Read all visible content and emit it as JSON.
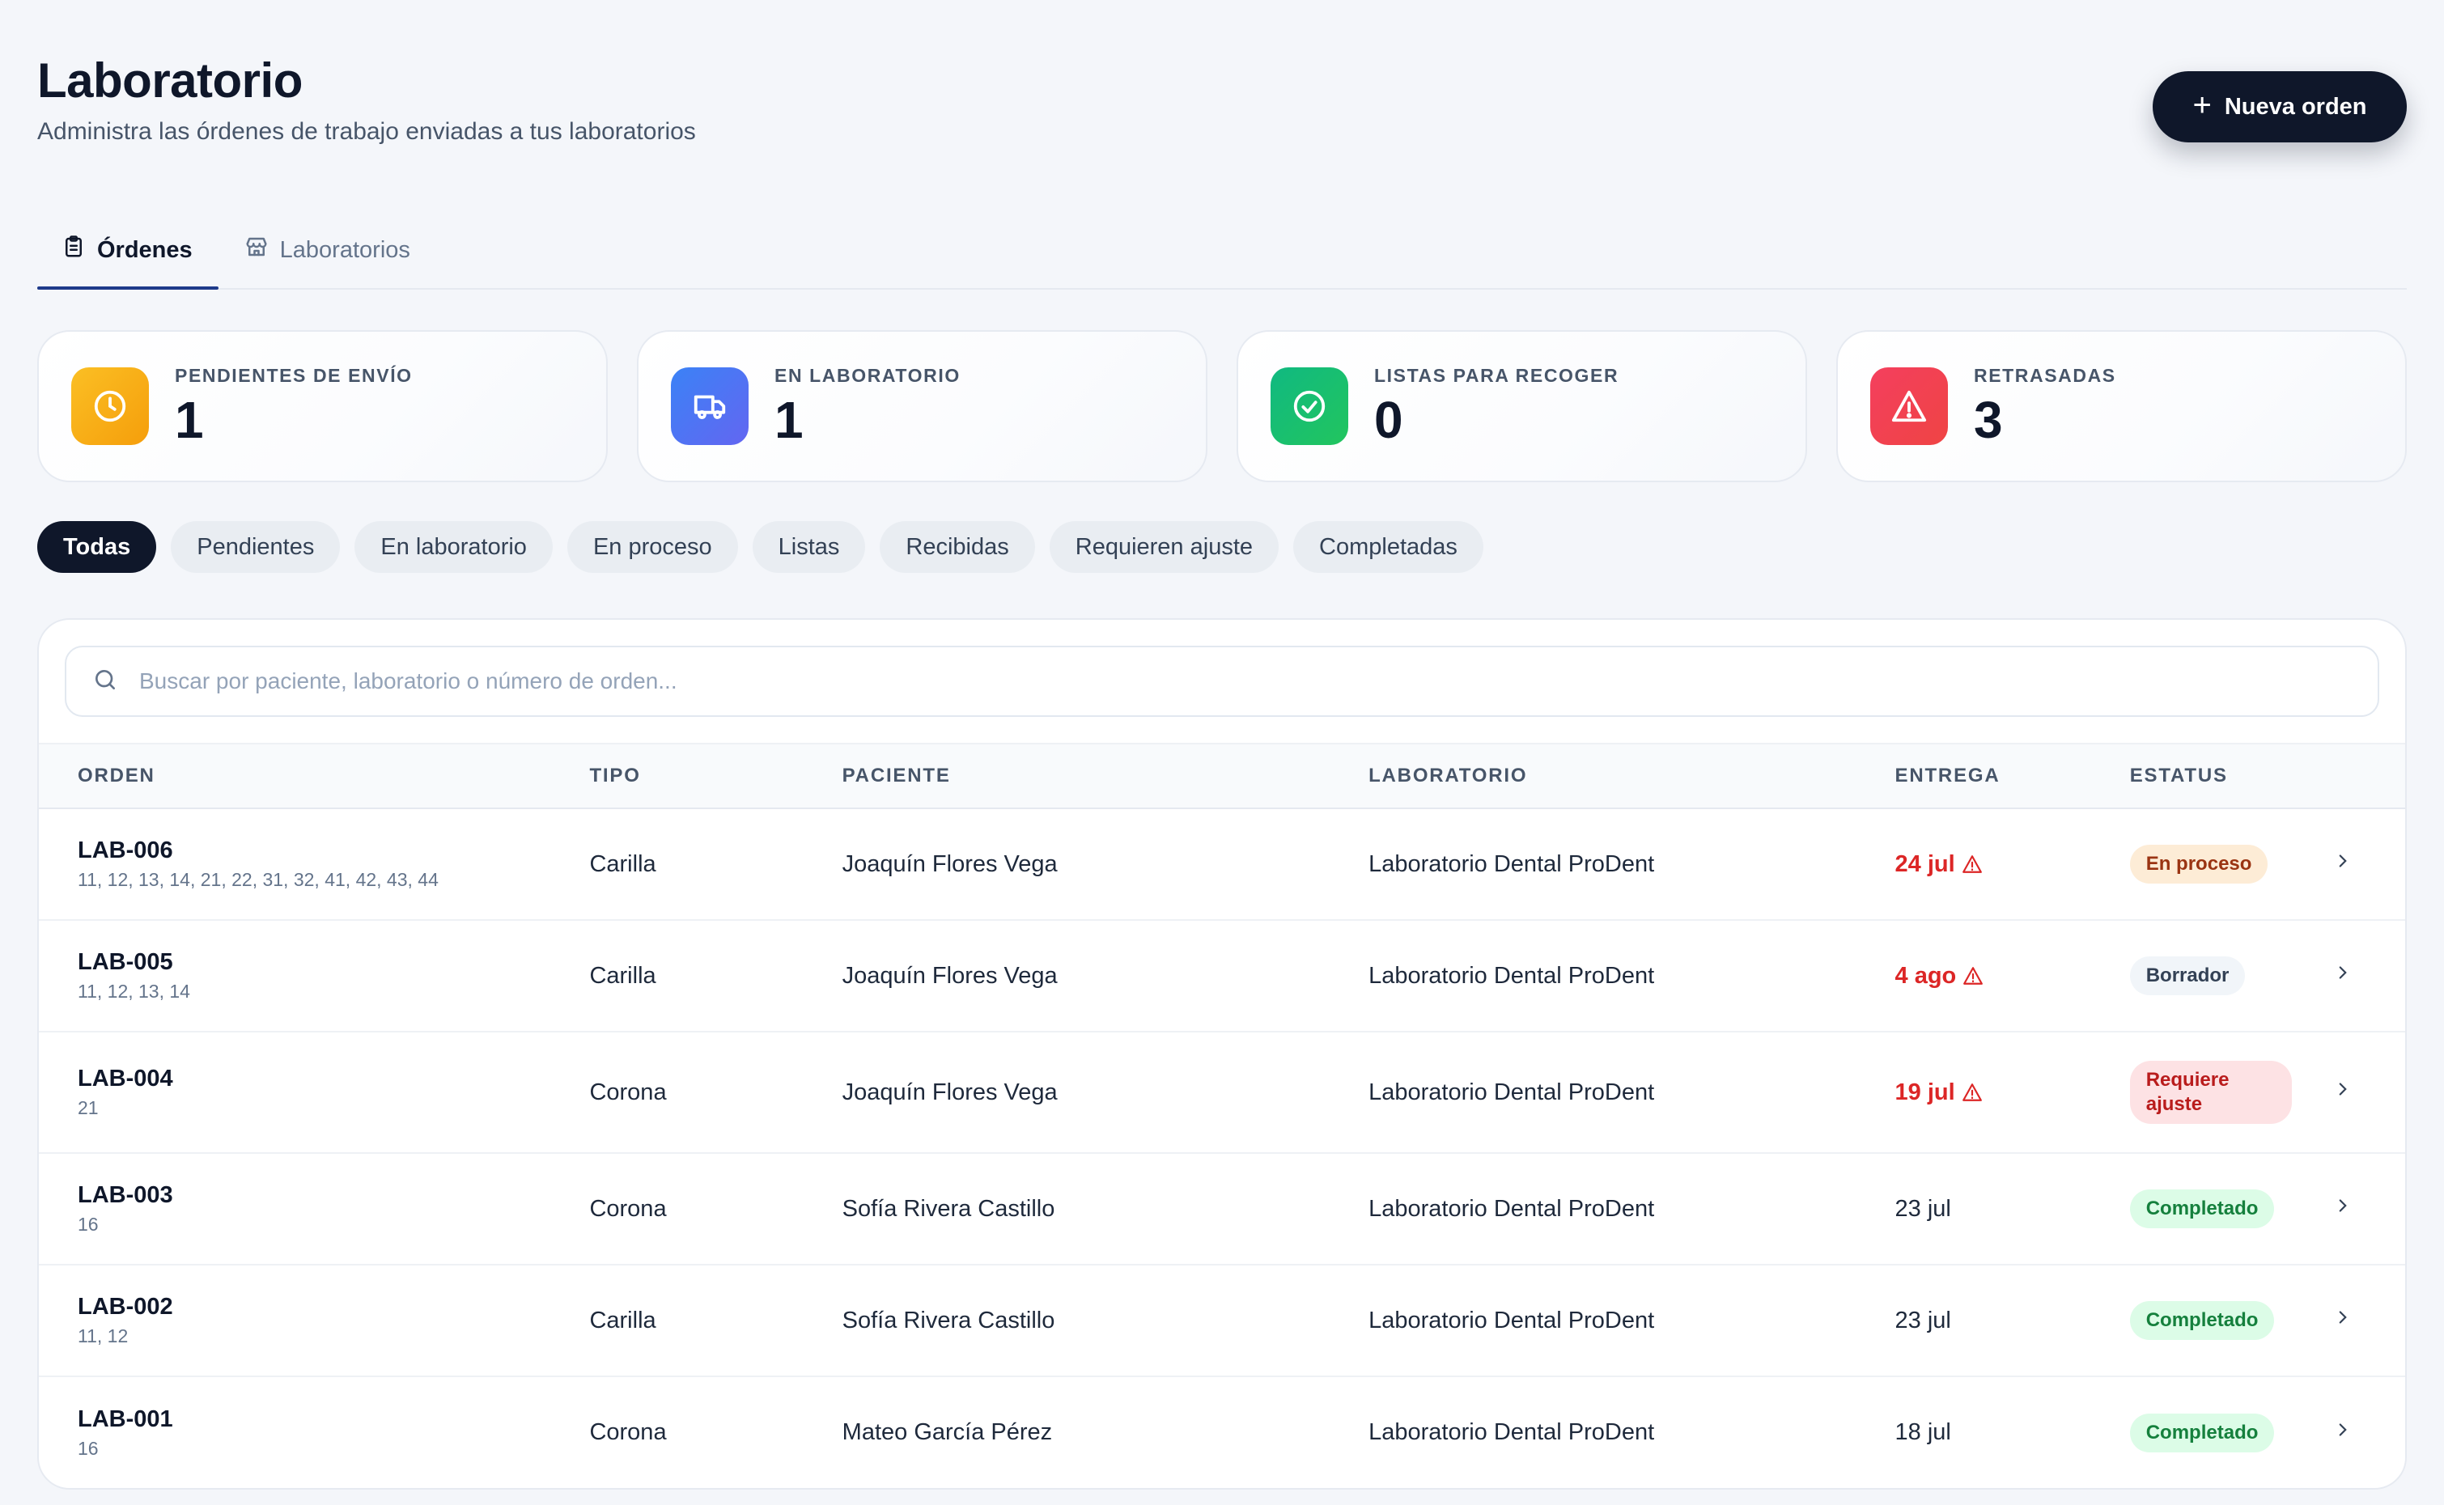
{
  "header": {
    "title": "Laboratorio",
    "subtitle": "Administra las órdenes de trabajo enviadas a tus laboratorios",
    "new_order_label": "Nueva orden"
  },
  "tabs": [
    {
      "label": "Órdenes",
      "icon": "clipboard-icon",
      "active": true
    },
    {
      "label": "Laboratorios",
      "icon": "store-icon",
      "active": false
    }
  ],
  "stats": [
    {
      "label": "PENDIENTES DE ENVÍO",
      "value": "1",
      "icon": "clock-icon",
      "color": "#f59e0b"
    },
    {
      "label": "EN LABORATORIO",
      "value": "1",
      "icon": "truck-icon",
      "color": "#4f6ef7"
    },
    {
      "label": "LISTAS PARA RECOGER",
      "value": "0",
      "icon": "check-circle-icon",
      "color": "#10b981"
    },
    {
      "label": "RETRASADAS",
      "value": "3",
      "icon": "alert-triangle-icon",
      "color": "#f43f5e"
    }
  ],
  "filters": [
    "Todas",
    "Pendientes",
    "En laboratorio",
    "En proceso",
    "Listas",
    "Recibidas",
    "Requieren ajuste",
    "Completadas"
  ],
  "search": {
    "placeholder": "Buscar por paciente, laboratorio o número de orden...",
    "value": ""
  },
  "table": {
    "headers": {
      "orden": "ORDEN",
      "tipo": "TIPO",
      "paciente": "PACIENTE",
      "laboratorio": "LABORATORIO",
      "entrega": "ENTREGA",
      "estatus": "ESTATUS"
    },
    "rows": [
      {
        "id": "LAB-006",
        "teeth": "11, 12, 13, 14, 21, 22, 31, 32, 41, 42, 43, 44",
        "tipo": "Carilla",
        "paciente": "Joaquín Flores Vega",
        "laboratorio": "Laboratorio Dental ProDent",
        "entrega": "24 jul",
        "late": true,
        "estatus": "En proceso"
      },
      {
        "id": "LAB-005",
        "teeth": "11, 12, 13, 14",
        "tipo": "Carilla",
        "paciente": "Joaquín Flores Vega",
        "laboratorio": "Laboratorio Dental ProDent",
        "entrega": "4 ago",
        "late": true,
        "estatus": "Borrador"
      },
      {
        "id": "LAB-004",
        "teeth": "21",
        "tipo": "Corona",
        "paciente": "Joaquín Flores Vega",
        "laboratorio": "Laboratorio Dental ProDent",
        "entrega": "19 jul",
        "late": true,
        "estatus": "Requiere ajuste"
      },
      {
        "id": "LAB-003",
        "teeth": "16",
        "tipo": "Corona",
        "paciente": "Sofía Rivera Castillo",
        "laboratorio": "Laboratorio Dental ProDent",
        "entrega": "23 jul",
        "late": false,
        "estatus": "Completado"
      },
      {
        "id": "LAB-002",
        "teeth": "11, 12",
        "tipo": "Carilla",
        "paciente": "Sofía Rivera Castillo",
        "laboratorio": "Laboratorio Dental ProDent",
        "entrega": "23 jul",
        "late": false,
        "estatus": "Completado"
      },
      {
        "id": "LAB-001",
        "teeth": "16",
        "tipo": "Corona",
        "paciente": "Mateo García Pérez",
        "laboratorio": "Laboratorio Dental ProDent",
        "entrega": "18 jul",
        "late": false,
        "estatus": "Completado"
      }
    ]
  }
}
